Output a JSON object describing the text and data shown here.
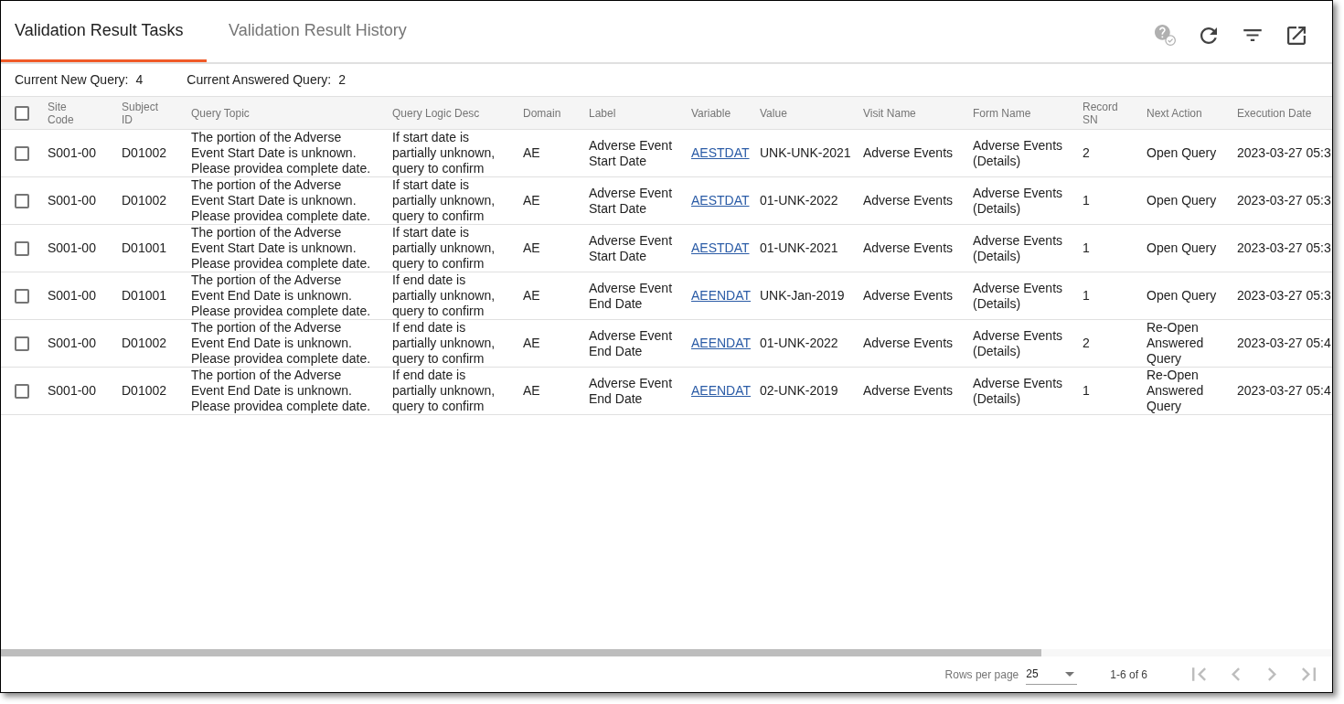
{
  "tabs": [
    {
      "label": "Validation Result Tasks",
      "selected": true
    },
    {
      "label": "Validation Result History",
      "selected": false
    }
  ],
  "toolbar": [
    {
      "kind": "help-check",
      "disabled": true
    },
    {
      "kind": "refresh",
      "disabled": false
    },
    {
      "kind": "filter",
      "disabled": false
    },
    {
      "kind": "open-external",
      "disabled": false
    }
  ],
  "summary": [
    {
      "label": "Current New Query:",
      "value": "4"
    },
    {
      "label": "Current Answered Query:",
      "value": "2"
    }
  ],
  "table": {
    "select_all": {
      "checked": false
    },
    "columns": [
      {
        "label": "Site Code",
        "kind": "text"
      },
      {
        "label": "Subject ID",
        "kind": "text"
      },
      {
        "label": "Query Topic",
        "kind": "text"
      },
      {
        "label": "Query Logic Desc",
        "kind": "text"
      },
      {
        "label": "Domain",
        "kind": "text"
      },
      {
        "label": "Label",
        "kind": "text"
      },
      {
        "label": "Variable",
        "kind": "link"
      },
      {
        "label": "Value",
        "kind": "text"
      },
      {
        "label": "Visit Name",
        "kind": "text"
      },
      {
        "label": "Form Name",
        "kind": "text"
      },
      {
        "label": "Record SN",
        "kind": "text"
      },
      {
        "label": "Next Action",
        "kind": "text"
      },
      {
        "label": "Execution Date",
        "kind": "text"
      }
    ],
    "rows": [
      {
        "checked": false,
        "cells": [
          "S001-00",
          "D01002",
          "The portion of the Adverse Event Start Date is unknown. Please providea complete date.",
          "If start date is partially unknown, query to confirm",
          "AE",
          "Adverse Event Start Date",
          "AESTDAT",
          "UNK-UNK-2021",
          "Adverse Events",
          "Adverse Events (Details)",
          "2",
          "Open Query",
          "2023-03-27 05:3"
        ]
      },
      {
        "checked": false,
        "cells": [
          "S001-00",
          "D01002",
          "The portion of the Adverse Event Start Date is unknown. Please providea complete date.",
          "If start date is partially unknown, query to confirm",
          "AE",
          "Adverse Event Start Date",
          "AESTDAT",
          "01-UNK-2022",
          "Adverse Events",
          "Adverse Events (Details)",
          "1",
          "Open Query",
          "2023-03-27 05:3"
        ]
      },
      {
        "checked": false,
        "cells": [
          "S001-00",
          "D01001",
          "The portion of the Adverse Event Start Date is unknown. Please providea complete date.",
          "If start date is partially unknown, query to confirm",
          "AE",
          "Adverse Event Start Date",
          "AESTDAT",
          "01-UNK-2021",
          "Adverse Events",
          "Adverse Events (Details)",
          "1",
          "Open Query",
          "2023-03-27 05:3"
        ]
      },
      {
        "checked": false,
        "cells": [
          "S001-00",
          "D01001",
          "The portion of the Adverse Event End Date is unknown. Please providea complete date.",
          "If end date is partially unknown, query to confirm",
          "AE",
          "Adverse Event End Date",
          "AEENDAT",
          "UNK-Jan-2019",
          "Adverse Events",
          "Adverse Events (Details)",
          "1",
          "Open Query",
          "2023-03-27 05:3"
        ]
      },
      {
        "checked": false,
        "cells": [
          "S001-00",
          "D01002",
          "The portion of the Adverse Event End Date is unknown. Please providea complete date.",
          "If end date is partially unknown, query to confirm",
          "AE",
          "Adverse Event End Date",
          "AEENDAT",
          "01-UNK-2022",
          "Adverse Events",
          "Adverse Events (Details)",
          "2",
          "Re-Open Answered Query",
          "2023-03-27 05:4"
        ]
      },
      {
        "checked": false,
        "cells": [
          "S001-00",
          "D01002",
          "The portion of the Adverse Event End Date is unknown. Please providea complete date.",
          "If end date is partially unknown, query to confirm",
          "AE",
          "Adverse Event End Date",
          "AEENDAT",
          "02-UNK-2019",
          "Adverse Events",
          "Adverse Events (Details)",
          "1",
          "Re-Open Answered Query",
          "2023-03-27 05:4"
        ]
      }
    ]
  },
  "pagination": {
    "rows_per_page_label": "Rows per page",
    "rows_per_page": "25",
    "range": "1-6 of 6",
    "buttons": [
      {
        "kind": "first",
        "disabled": true
      },
      {
        "kind": "previous",
        "disabled": true
      },
      {
        "kind": "next",
        "disabled": true
      },
      {
        "kind": "last",
        "disabled": true
      }
    ]
  }
}
